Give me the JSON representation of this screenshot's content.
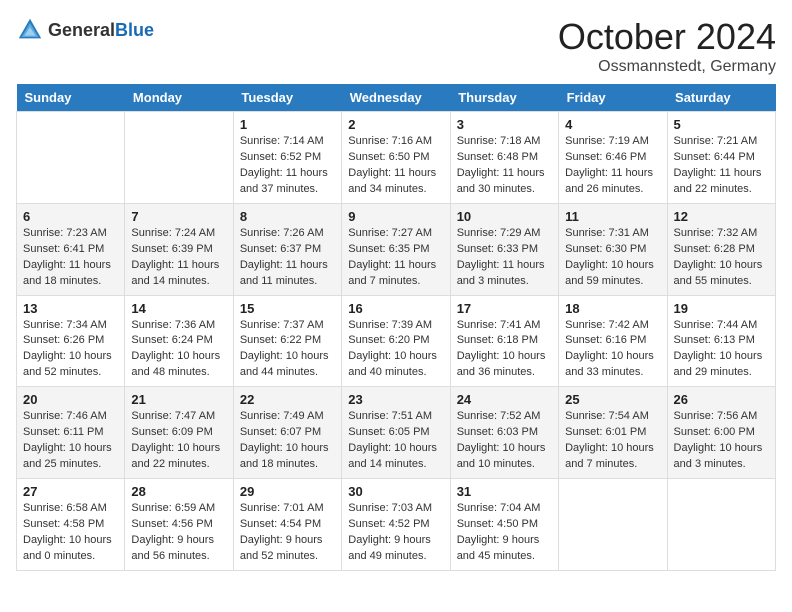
{
  "header": {
    "logo_general": "General",
    "logo_blue": "Blue",
    "month": "October 2024",
    "location": "Ossmannstedt, Germany"
  },
  "days_of_week": [
    "Sunday",
    "Monday",
    "Tuesday",
    "Wednesday",
    "Thursday",
    "Friday",
    "Saturday"
  ],
  "weeks": [
    [
      {
        "day": "",
        "info": ""
      },
      {
        "day": "",
        "info": ""
      },
      {
        "day": "1",
        "info": "Sunrise: 7:14 AM\nSunset: 6:52 PM\nDaylight: 11 hours and 37 minutes."
      },
      {
        "day": "2",
        "info": "Sunrise: 7:16 AM\nSunset: 6:50 PM\nDaylight: 11 hours and 34 minutes."
      },
      {
        "day": "3",
        "info": "Sunrise: 7:18 AM\nSunset: 6:48 PM\nDaylight: 11 hours and 30 minutes."
      },
      {
        "day": "4",
        "info": "Sunrise: 7:19 AM\nSunset: 6:46 PM\nDaylight: 11 hours and 26 minutes."
      },
      {
        "day": "5",
        "info": "Sunrise: 7:21 AM\nSunset: 6:44 PM\nDaylight: 11 hours and 22 minutes."
      }
    ],
    [
      {
        "day": "6",
        "info": "Sunrise: 7:23 AM\nSunset: 6:41 PM\nDaylight: 11 hours and 18 minutes."
      },
      {
        "day": "7",
        "info": "Sunrise: 7:24 AM\nSunset: 6:39 PM\nDaylight: 11 hours and 14 minutes."
      },
      {
        "day": "8",
        "info": "Sunrise: 7:26 AM\nSunset: 6:37 PM\nDaylight: 11 hours and 11 minutes."
      },
      {
        "day": "9",
        "info": "Sunrise: 7:27 AM\nSunset: 6:35 PM\nDaylight: 11 hours and 7 minutes."
      },
      {
        "day": "10",
        "info": "Sunrise: 7:29 AM\nSunset: 6:33 PM\nDaylight: 11 hours and 3 minutes."
      },
      {
        "day": "11",
        "info": "Sunrise: 7:31 AM\nSunset: 6:30 PM\nDaylight: 10 hours and 59 minutes."
      },
      {
        "day": "12",
        "info": "Sunrise: 7:32 AM\nSunset: 6:28 PM\nDaylight: 10 hours and 55 minutes."
      }
    ],
    [
      {
        "day": "13",
        "info": "Sunrise: 7:34 AM\nSunset: 6:26 PM\nDaylight: 10 hours and 52 minutes."
      },
      {
        "day": "14",
        "info": "Sunrise: 7:36 AM\nSunset: 6:24 PM\nDaylight: 10 hours and 48 minutes."
      },
      {
        "day": "15",
        "info": "Sunrise: 7:37 AM\nSunset: 6:22 PM\nDaylight: 10 hours and 44 minutes."
      },
      {
        "day": "16",
        "info": "Sunrise: 7:39 AM\nSunset: 6:20 PM\nDaylight: 10 hours and 40 minutes."
      },
      {
        "day": "17",
        "info": "Sunrise: 7:41 AM\nSunset: 6:18 PM\nDaylight: 10 hours and 36 minutes."
      },
      {
        "day": "18",
        "info": "Sunrise: 7:42 AM\nSunset: 6:16 PM\nDaylight: 10 hours and 33 minutes."
      },
      {
        "day": "19",
        "info": "Sunrise: 7:44 AM\nSunset: 6:13 PM\nDaylight: 10 hours and 29 minutes."
      }
    ],
    [
      {
        "day": "20",
        "info": "Sunrise: 7:46 AM\nSunset: 6:11 PM\nDaylight: 10 hours and 25 minutes."
      },
      {
        "day": "21",
        "info": "Sunrise: 7:47 AM\nSunset: 6:09 PM\nDaylight: 10 hours and 22 minutes."
      },
      {
        "day": "22",
        "info": "Sunrise: 7:49 AM\nSunset: 6:07 PM\nDaylight: 10 hours and 18 minutes."
      },
      {
        "day": "23",
        "info": "Sunrise: 7:51 AM\nSunset: 6:05 PM\nDaylight: 10 hours and 14 minutes."
      },
      {
        "day": "24",
        "info": "Sunrise: 7:52 AM\nSunset: 6:03 PM\nDaylight: 10 hours and 10 minutes."
      },
      {
        "day": "25",
        "info": "Sunrise: 7:54 AM\nSunset: 6:01 PM\nDaylight: 10 hours and 7 minutes."
      },
      {
        "day": "26",
        "info": "Sunrise: 7:56 AM\nSunset: 6:00 PM\nDaylight: 10 hours and 3 minutes."
      }
    ],
    [
      {
        "day": "27",
        "info": "Sunrise: 6:58 AM\nSunset: 4:58 PM\nDaylight: 10 hours and 0 minutes."
      },
      {
        "day": "28",
        "info": "Sunrise: 6:59 AM\nSunset: 4:56 PM\nDaylight: 9 hours and 56 minutes."
      },
      {
        "day": "29",
        "info": "Sunrise: 7:01 AM\nSunset: 4:54 PM\nDaylight: 9 hours and 52 minutes."
      },
      {
        "day": "30",
        "info": "Sunrise: 7:03 AM\nSunset: 4:52 PM\nDaylight: 9 hours and 49 minutes."
      },
      {
        "day": "31",
        "info": "Sunrise: 7:04 AM\nSunset: 4:50 PM\nDaylight: 9 hours and 45 minutes."
      },
      {
        "day": "",
        "info": ""
      },
      {
        "day": "",
        "info": ""
      }
    ]
  ]
}
